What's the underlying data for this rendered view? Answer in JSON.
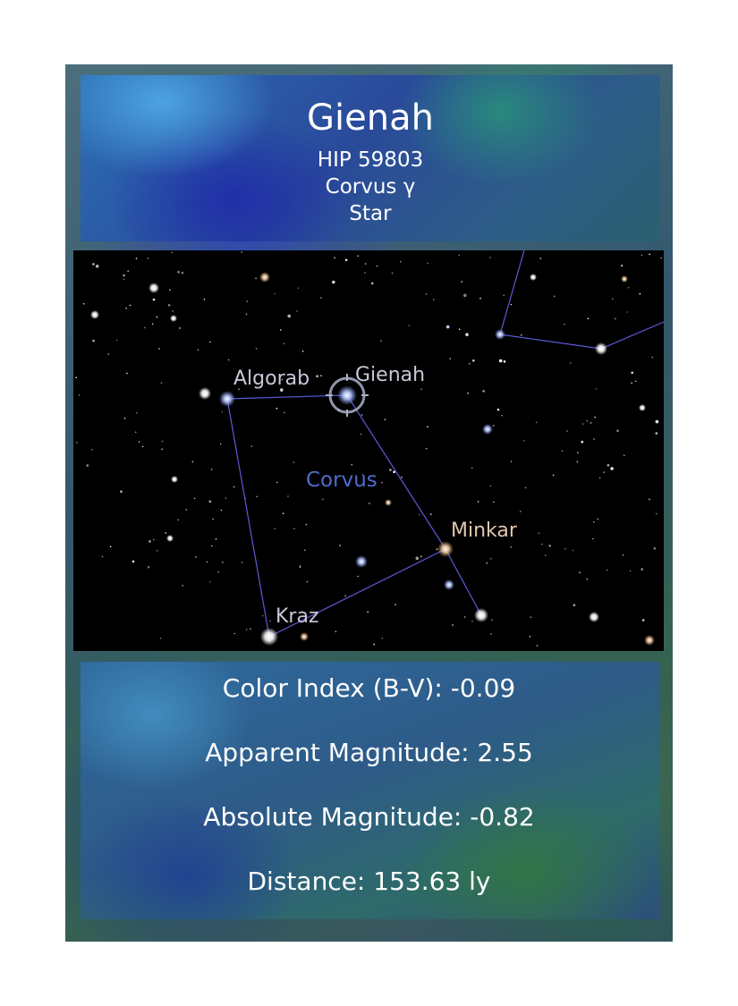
{
  "star": {
    "name": "Gienah",
    "catalog_id": "HIP 59803",
    "designation": "Corvus γ",
    "object_type": "Star"
  },
  "sky_map": {
    "constellation_label": "Corvus",
    "star_labels": {
      "algorab": "Algorab",
      "gienah": "Gienah",
      "minkar": "Minkar",
      "kraz": "Kraz"
    },
    "colors": {
      "background": "#000000",
      "constellation_line": "#5a5ad8",
      "constellation_label": "#4f6bc9",
      "star_label": "#c8c8d8",
      "minkar_label": "#e0c8b0"
    },
    "selected_star": "Gienah"
  },
  "details": {
    "color_index": "Color Index (B-V): -0.09",
    "apparent_magnitude": "Apparent Magnitude: 2.55",
    "absolute_magnitude": "Absolute Magnitude: -0.82",
    "distance": "Distance: 153.63 ly"
  }
}
